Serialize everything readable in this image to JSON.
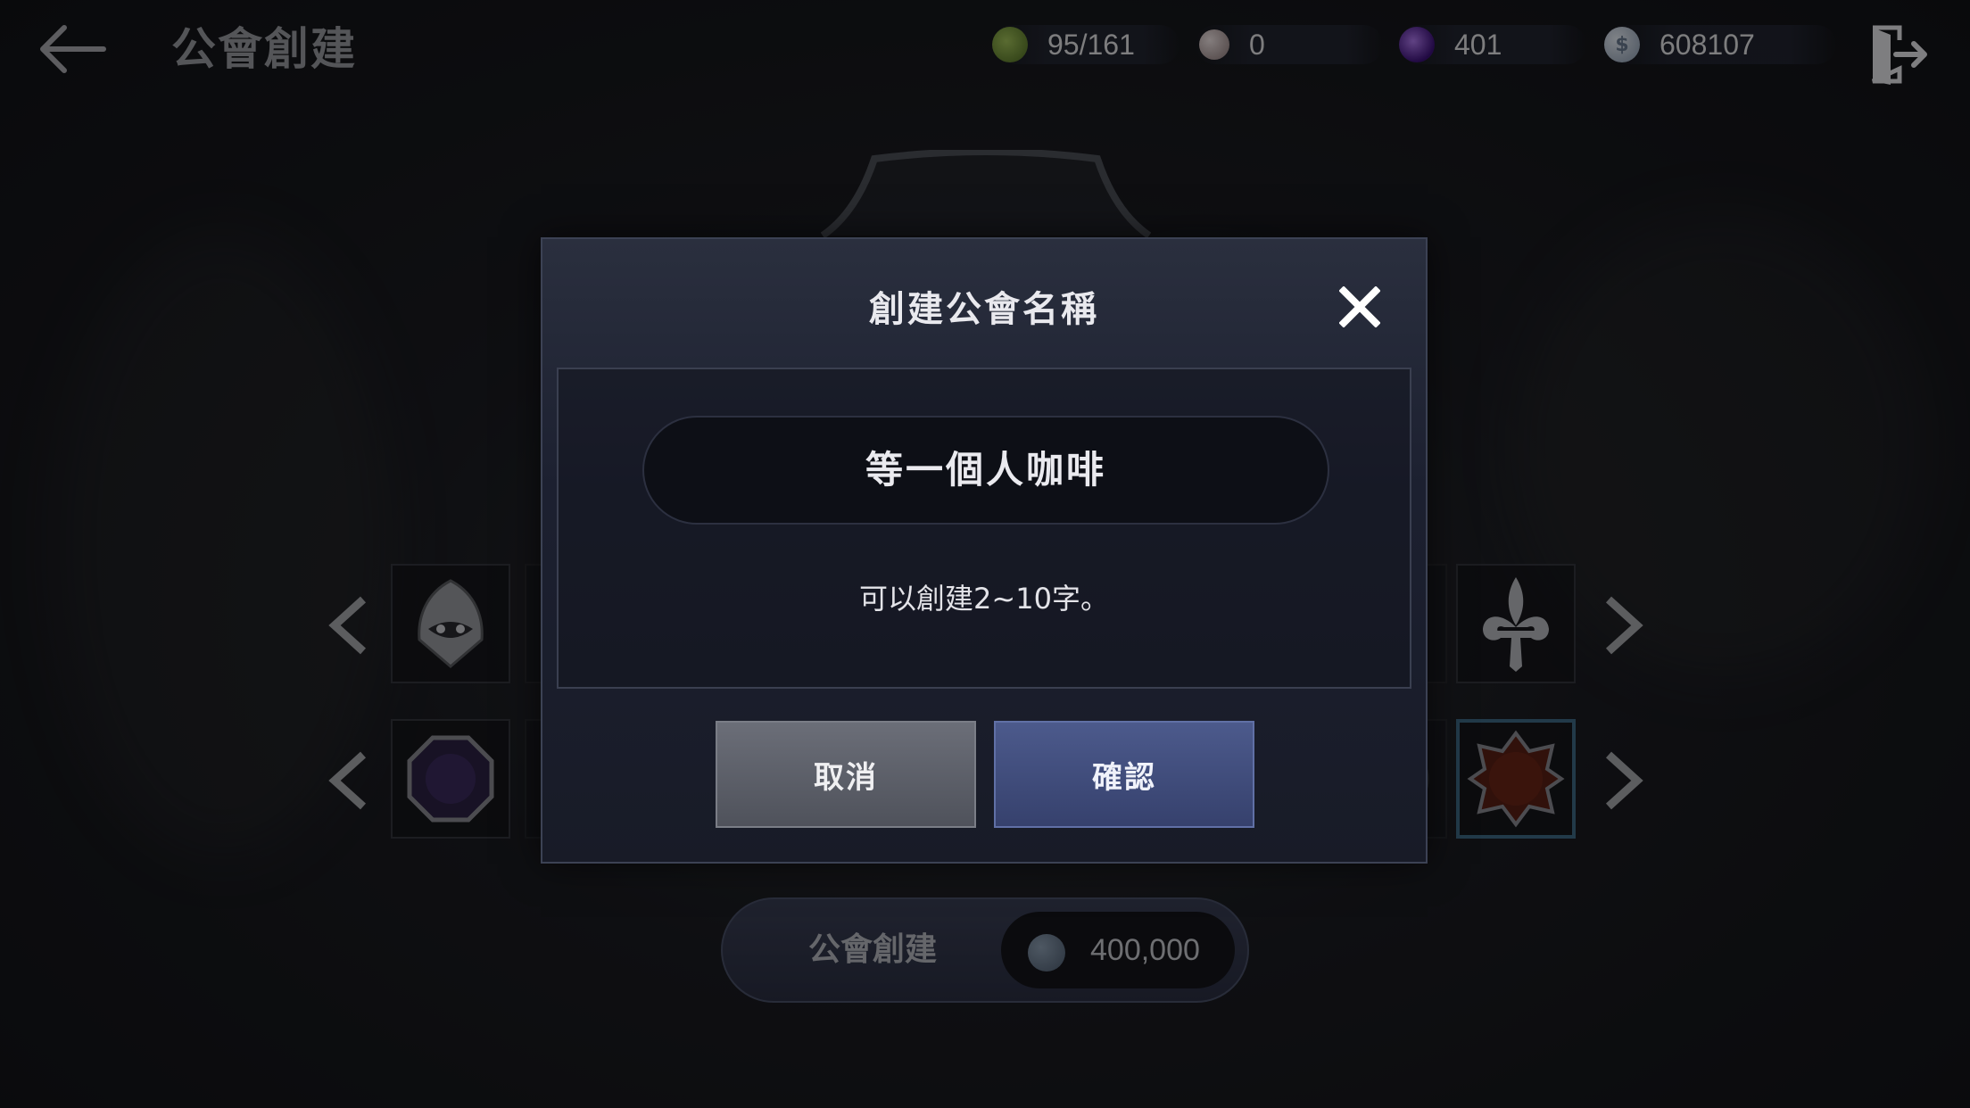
{
  "header": {
    "title": "公會創建",
    "back_icon": "back-arrow-icon",
    "exit_icon": "exit-door-icon"
  },
  "resources": [
    {
      "icon": "stamina-icon",
      "value": "95/161",
      "color": "#6b8e3a"
    },
    {
      "icon": "pearl-icon",
      "value": "0",
      "color": "#b8a8a8"
    },
    {
      "icon": "purple-gem-icon",
      "value": "401",
      "color": "#6a2fb0"
    },
    {
      "icon": "silver-coin-icon",
      "value": "608107",
      "color": "#a9b8ca"
    }
  ],
  "emblem_picker": {
    "row1_icons": [
      "hooded-mask-icon",
      "wing-icon",
      "mug-icon",
      "crescent-icon",
      "pyramid-icon",
      "sword-icon",
      "star-icon",
      "fist-icon",
      "fleur-de-lis-icon"
    ],
    "row2_icons": [
      "purple-octagon-icon",
      "dark-circle-icon",
      "banner-icon",
      "frame-icon",
      "round-frame-icon",
      "red-octagram-icon"
    ]
  },
  "create_button": {
    "label": "公會創建",
    "cost": "400,000",
    "cost_icon": "silver-coin-icon"
  },
  "dialog": {
    "title": "創建公會名稱",
    "name_value": "等一個人咖啡",
    "hint": "可以創建2~10字。",
    "cancel_label": "取消",
    "confirm_label": "確認"
  },
  "colors": {
    "accent_blue": "#36416d",
    "selected_border": "#3f6a86",
    "background": "#1b1c21"
  }
}
